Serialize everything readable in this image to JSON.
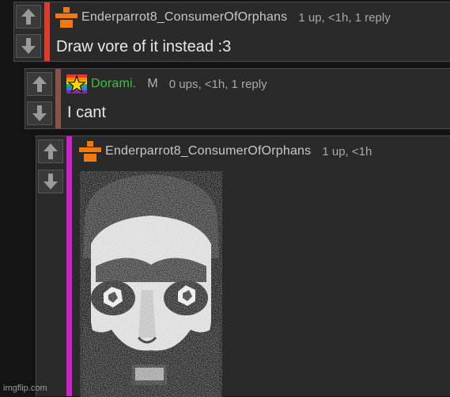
{
  "colors": {
    "page_bg": "#141414",
    "comment_bg": "#2a2a2a",
    "bar_red": "#e23a2c",
    "bar_brown": "#8a5248",
    "bar_magenta": "#cc22cc",
    "username_green": "#3cc43c",
    "badge_orange": "#f07a10"
  },
  "comments": [
    {
      "username": "Enderparrot8_ConsumerOfOrphans",
      "meta": "1 up, <1h, 1 reply",
      "text": "Draw vore of it instead :3",
      "badge_icon": "orange-user-badge-icon",
      "bar_color": "#e23a2c"
    },
    {
      "username": "Dorami.",
      "mod_label": "M",
      "meta": "0 ups, <1h, 1 reply",
      "text": "I cant",
      "badge_icon": "rainbow-star-badge-icon",
      "bar_color": "#8a5248"
    },
    {
      "username": "Enderparrot8_ConsumerOfOrphans",
      "meta": "1 up, <1h",
      "badge_icon": "orange-user-badge-icon",
      "bar_color": "#cc22cc",
      "image": "grainy-face-image"
    }
  ],
  "watermark": "imgflip.com"
}
